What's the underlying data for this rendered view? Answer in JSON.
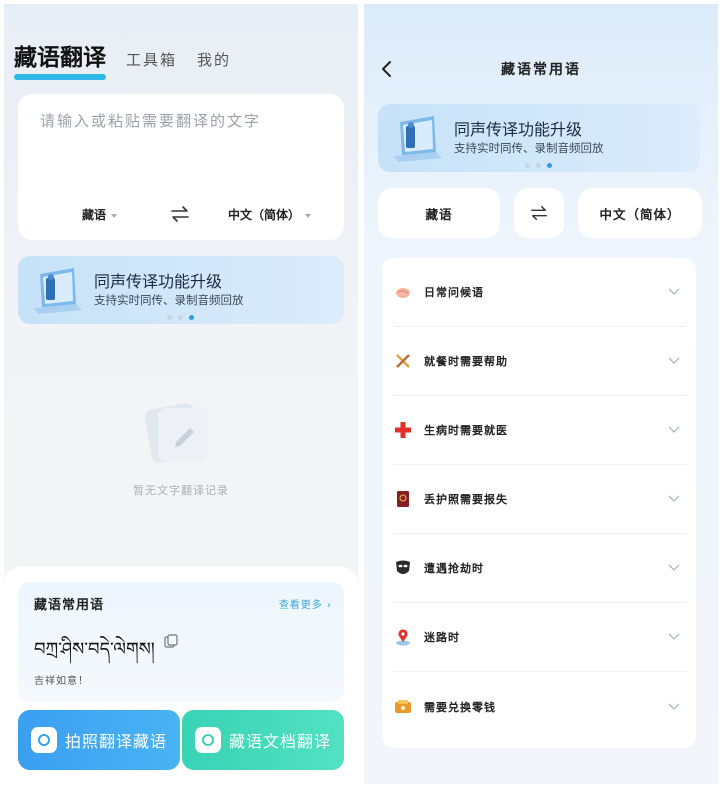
{
  "left": {
    "tabs": [
      "藏语翻译",
      "工具箱",
      "我的"
    ],
    "input_placeholder": "请输入或粘贴需要翻译的文字",
    "source_lang": "藏语",
    "target_lang": "中文（简体）",
    "banner": {
      "title": "同声传译功能升级",
      "subtitle": "支持实时同传、录制音频回放"
    },
    "empty_text": "暂无文字翻译记录",
    "phrase_card": {
      "title": "藏语常用语",
      "more": "查看更多 ›",
      "tibetan": "བཀྲ་ཤིས་བདེ་ལེགས།",
      "chinese": "吉祥如意！"
    },
    "buttons": {
      "photo": "拍照翻译藏语",
      "doc": "藏语文档翻译"
    }
  },
  "right": {
    "title": "藏语常用语",
    "banner": {
      "title": "同声传译功能升级",
      "subtitle": "支持实时同传、录制音频回放"
    },
    "source_lang": "藏语",
    "target_lang": "中文（简体）",
    "categories": [
      {
        "label": "日常问候语",
        "icon": "handshake-icon"
      },
      {
        "label": "就餐时需要帮助",
        "icon": "cutlery-icon"
      },
      {
        "label": "生病时需要就医",
        "icon": "red-cross-icon"
      },
      {
        "label": "丢护照需要报失",
        "icon": "passport-icon"
      },
      {
        "label": "遭遇抢劫时",
        "icon": "mask-icon"
      },
      {
        "label": "迷路时",
        "icon": "map-pin-icon"
      },
      {
        "label": "需要兑换零钱",
        "icon": "wallet-icon"
      }
    ]
  },
  "colors": {
    "accent": "#31b8e9",
    "photo_button": "#3b9ff0",
    "doc_button": "#39d3b5"
  }
}
